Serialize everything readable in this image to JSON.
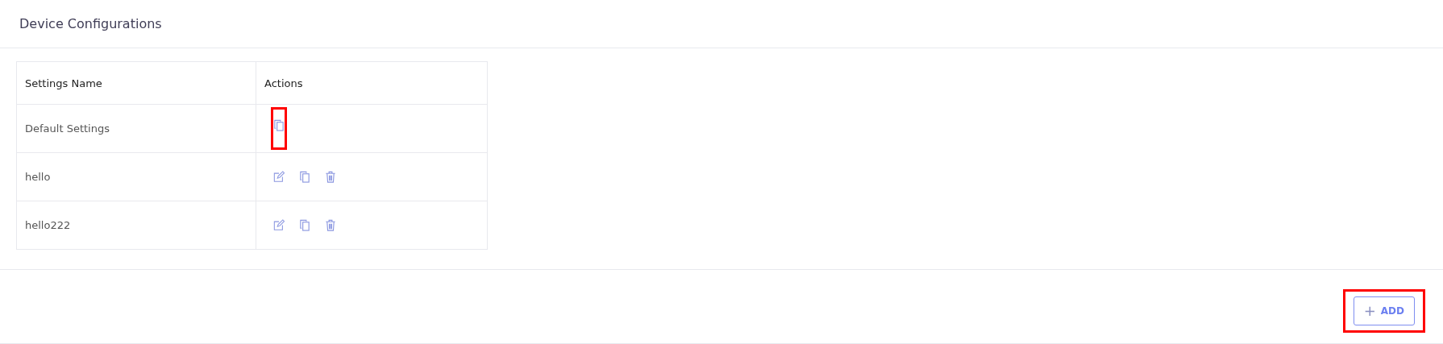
{
  "title": "Device Configurations",
  "table": {
    "columns": [
      "Settings Name",
      "Actions"
    ],
    "rows": [
      {
        "name": "Default Settings",
        "actions": [
          {
            "kind": "copy",
            "highlighted": true
          }
        ]
      },
      {
        "name": "hello",
        "actions": [
          {
            "kind": "edit",
            "highlighted": false
          },
          {
            "kind": "copy",
            "highlighted": false
          },
          {
            "kind": "delete",
            "highlighted": false
          }
        ]
      },
      {
        "name": "hello222",
        "actions": [
          {
            "kind": "edit",
            "highlighted": false
          },
          {
            "kind": "copy",
            "highlighted": false
          },
          {
            "kind": "delete",
            "highlighted": false
          }
        ]
      }
    ]
  },
  "add_button": {
    "icon": "+",
    "label": "ADD",
    "highlighted": true
  }
}
